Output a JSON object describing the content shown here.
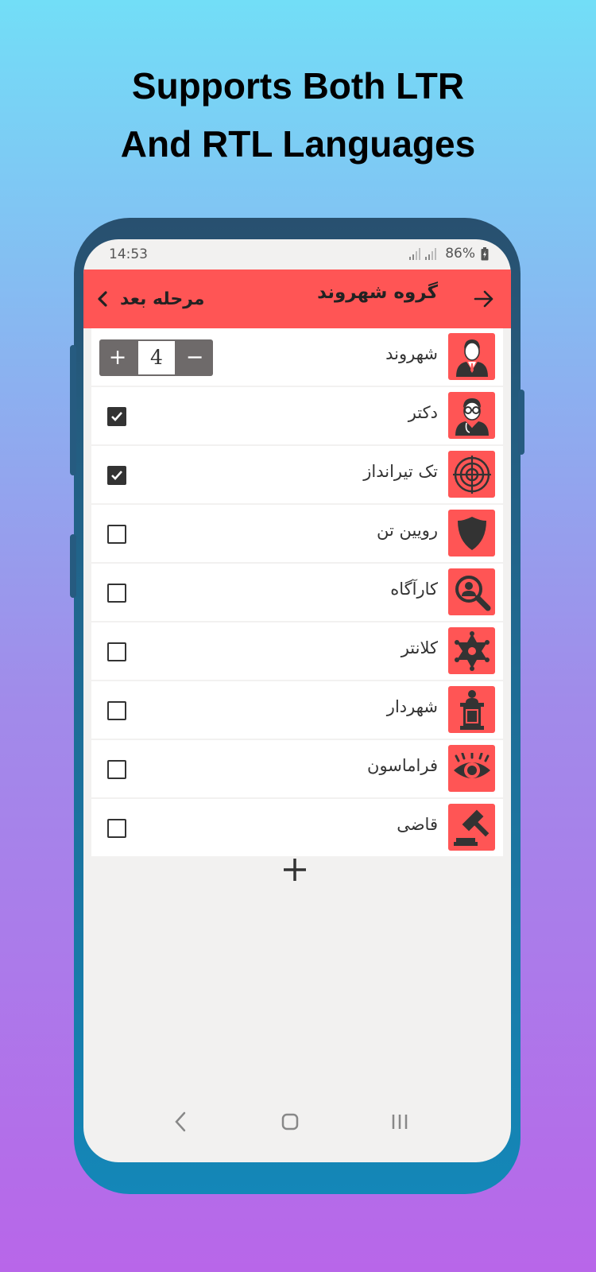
{
  "headline": {
    "line1": "Supports Both LTR",
    "line2": "And RTL Languages"
  },
  "status_bar": {
    "time": "14:53",
    "battery": "86%"
  },
  "app_bar": {
    "title": "گروه شهروند",
    "next_label": "مرحله بعد"
  },
  "roles": [
    {
      "name": "شهروند",
      "icon": "citizen-icon",
      "control": "stepper",
      "count": "4"
    },
    {
      "name": "دکتر",
      "icon": "doctor-icon",
      "control": "checkbox",
      "checked": true
    },
    {
      "name": "تک تیرانداز",
      "icon": "crosshair-icon",
      "control": "checkbox",
      "checked": true
    },
    {
      "name": "رویین تن",
      "icon": "shield-icon",
      "control": "checkbox",
      "checked": false
    },
    {
      "name": "کارآگاه",
      "icon": "detective-icon",
      "control": "checkbox",
      "checked": false
    },
    {
      "name": "کلانتر",
      "icon": "sheriff-star-icon",
      "control": "checkbox",
      "checked": false
    },
    {
      "name": "شهردار",
      "icon": "podium-icon",
      "control": "checkbox",
      "checked": false
    },
    {
      "name": "فراماسون",
      "icon": "eye-icon",
      "control": "checkbox",
      "checked": false
    },
    {
      "name": "قاضی",
      "icon": "gavel-icon",
      "control": "checkbox",
      "checked": false
    }
  ],
  "stepper": {
    "plus": "+",
    "minus": "−"
  },
  "colors": {
    "accent": "#ff5555",
    "frame": "#1e6d96"
  }
}
